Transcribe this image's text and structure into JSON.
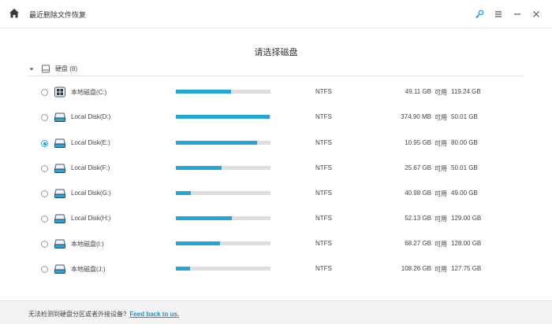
{
  "app": {
    "title": "最近删除文件恢复",
    "heading": "请选择磁盘"
  },
  "toolbar": {
    "icons": [
      "home-icon",
      "key-icon",
      "menu-icon",
      "minimize-icon",
      "close-icon"
    ]
  },
  "group": {
    "label": "硬盘 (8)"
  },
  "accent_color": "#21a6d8",
  "disks": [
    {
      "name": "本地磁盘(C:)",
      "fs": "NTFS",
      "used": "49.11 GB",
      "avail_label": "可用",
      "available": "119.24 GB",
      "usage": 0.58,
      "selected": false,
      "icon": "windows-drive-icon"
    },
    {
      "name": "Local Disk(D:)",
      "fs": "NTFS",
      "used": "374.90 MB",
      "avail_label": "可用",
      "available": "50.01 GB",
      "usage": 0.99,
      "selected": false,
      "icon": "drive-icon"
    },
    {
      "name": "Local Disk(E:)",
      "fs": "NTFS",
      "used": "10.95 GB",
      "avail_label": "可用",
      "available": "80.00 GB",
      "usage": 0.86,
      "selected": true,
      "icon": "drive-icon"
    },
    {
      "name": "Local Disk(F:)",
      "fs": "NTFS",
      "used": "25.67 GB",
      "avail_label": "可用",
      "available": "50.01 GB",
      "usage": 0.48,
      "selected": false,
      "icon": "drive-icon"
    },
    {
      "name": "Local Disk(G:)",
      "fs": "NTFS",
      "used": "40.98 GB",
      "avail_label": "可用",
      "available": "49.00 GB",
      "usage": 0.16,
      "selected": false,
      "icon": "drive-icon"
    },
    {
      "name": "Local Disk(H:)",
      "fs": "NTFS",
      "used": "52.13 GB",
      "avail_label": "可用",
      "available": "129.00 GB",
      "usage": 0.59,
      "selected": false,
      "icon": "drive-icon"
    },
    {
      "name": "本地磁盘(I:)",
      "fs": "NTFS",
      "used": "68.27 GB",
      "avail_label": "可用",
      "available": "128.00 GB",
      "usage": 0.47,
      "selected": false,
      "icon": "drive-icon"
    },
    {
      "name": "本地磁盘(J:)",
      "fs": "NTFS",
      "used": "108.26 GB",
      "avail_label": "可用",
      "available": "127.75 GB",
      "usage": 0.15,
      "selected": false,
      "icon": "drive-icon"
    }
  ],
  "footer": {
    "text": "无法检测到硬盘分区或者外接设备?",
    "link": "Feed back to us."
  }
}
